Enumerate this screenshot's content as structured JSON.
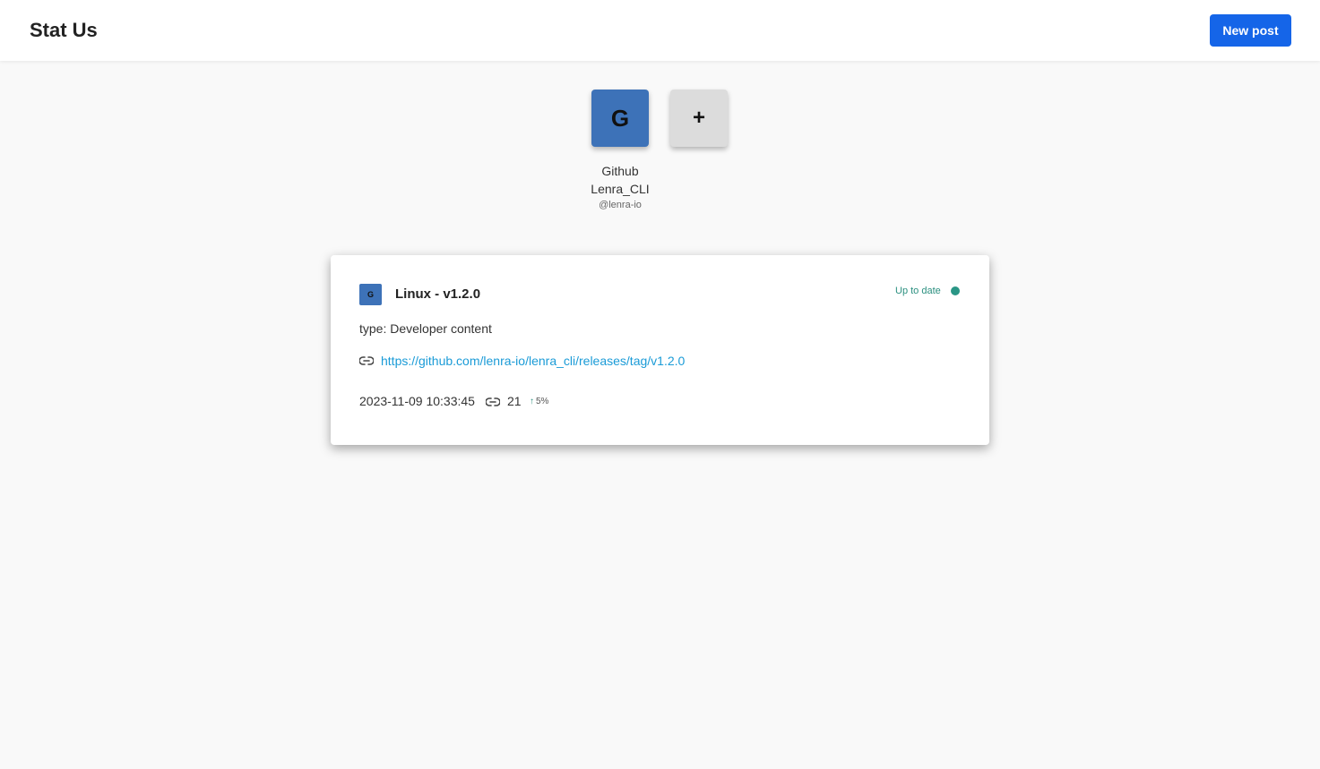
{
  "header": {
    "brand": "Stat Us",
    "new_post_label": "New post"
  },
  "sources": {
    "github_tile_letter": "G",
    "add_tile_symbol": "+",
    "github_name": "Github",
    "github_project": "Lenra_CLI",
    "github_handle": "@lenra-io"
  },
  "card": {
    "avatar_letter": "G",
    "title": "Linux - v1.2.0",
    "status": "Up to date",
    "status_color": "#2a9686",
    "type_line": "type: Developer content",
    "url": "https://github.com/lenra-io/lenra_cli/releases/tag/v1.2.0",
    "date": "2023-11-09 10:33:45",
    "link_count": "21",
    "trend_arrow": "↑",
    "trend_value": "5%"
  },
  "colors": {
    "accent": "#1565e8",
    "github_tile": "#3d72b8",
    "link": "#1a9bd7"
  }
}
